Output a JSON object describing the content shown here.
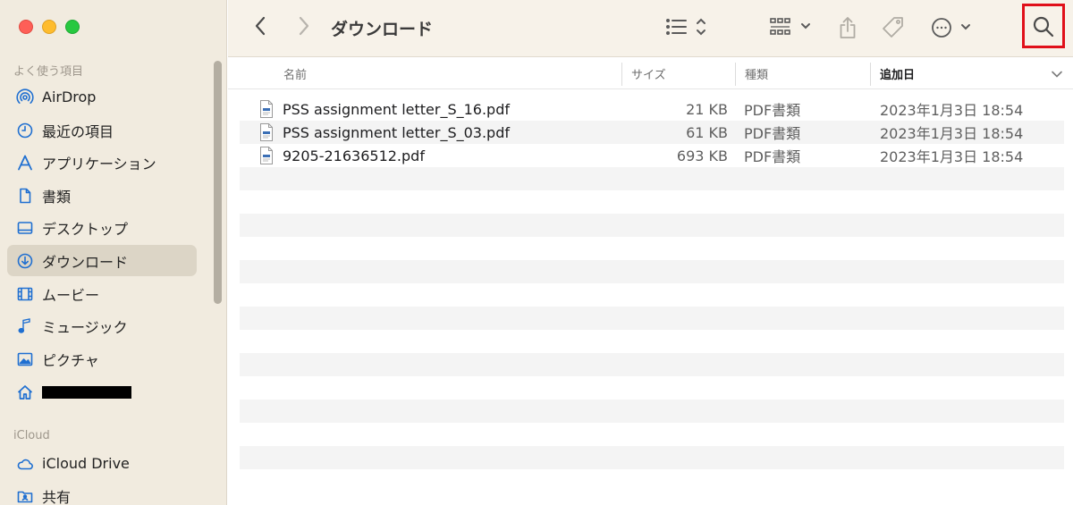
{
  "window": {
    "title": "ダウンロード"
  },
  "sidebar": {
    "favorites_title": "よく使う項目",
    "favorites": [
      {
        "label": "AirDrop",
        "icon": "airdrop-icon"
      },
      {
        "label": "最近の項目",
        "icon": "recents-clock-icon"
      },
      {
        "label": "アプリケーション",
        "icon": "applications-icon"
      },
      {
        "label": "書類",
        "icon": "document-icon"
      },
      {
        "label": "デスクトップ",
        "icon": "desktop-icon"
      },
      {
        "label": "ダウンロード",
        "icon": "download-icon",
        "selected": true
      },
      {
        "label": "ムービー",
        "icon": "movie-film-icon"
      },
      {
        "label": "ミュージック",
        "icon": "music-note-icon"
      },
      {
        "label": "ピクチャ",
        "icon": "photo-icon"
      },
      {
        "label": "",
        "icon": "home-icon",
        "redacted": true
      }
    ],
    "icloud_title": "iCloud",
    "icloud": [
      {
        "label": "iCloud Drive",
        "icon": "cloud-icon"
      },
      {
        "label": "共有",
        "icon": "shared-folder-icon"
      }
    ]
  },
  "toolbar": {
    "back": "chevron-left-icon",
    "forward": "chevron-right-icon",
    "view_mode": "list-view-icon",
    "group": "grid-group-icon",
    "share": "share-icon",
    "tag": "tag-icon",
    "more": "more-ellipsis-icon",
    "search": "search-icon"
  },
  "columns": {
    "name": "名前",
    "size": "サイズ",
    "kind": "種類",
    "date_added": "追加日"
  },
  "files": [
    {
      "name": "PSS assignment letter_S_16.pdf",
      "size": "21 KB",
      "kind": "PDF書類",
      "date": "2023年1月3日 18:54"
    },
    {
      "name": "PSS assignment letter_S_03.pdf",
      "size": "61 KB",
      "kind": "PDF書類",
      "date": "2023年1月3日 18:54"
    },
    {
      "name": "9205-21636512.pdf",
      "size": "693 KB",
      "kind": "PDF書類",
      "date": "2023年1月3日 18:54"
    }
  ],
  "colors": {
    "accent": "#1f6fd1",
    "sidebar_bg": "#f1ebdf",
    "selection": "#dcd5c6",
    "highlight_box": "#e0101a"
  }
}
